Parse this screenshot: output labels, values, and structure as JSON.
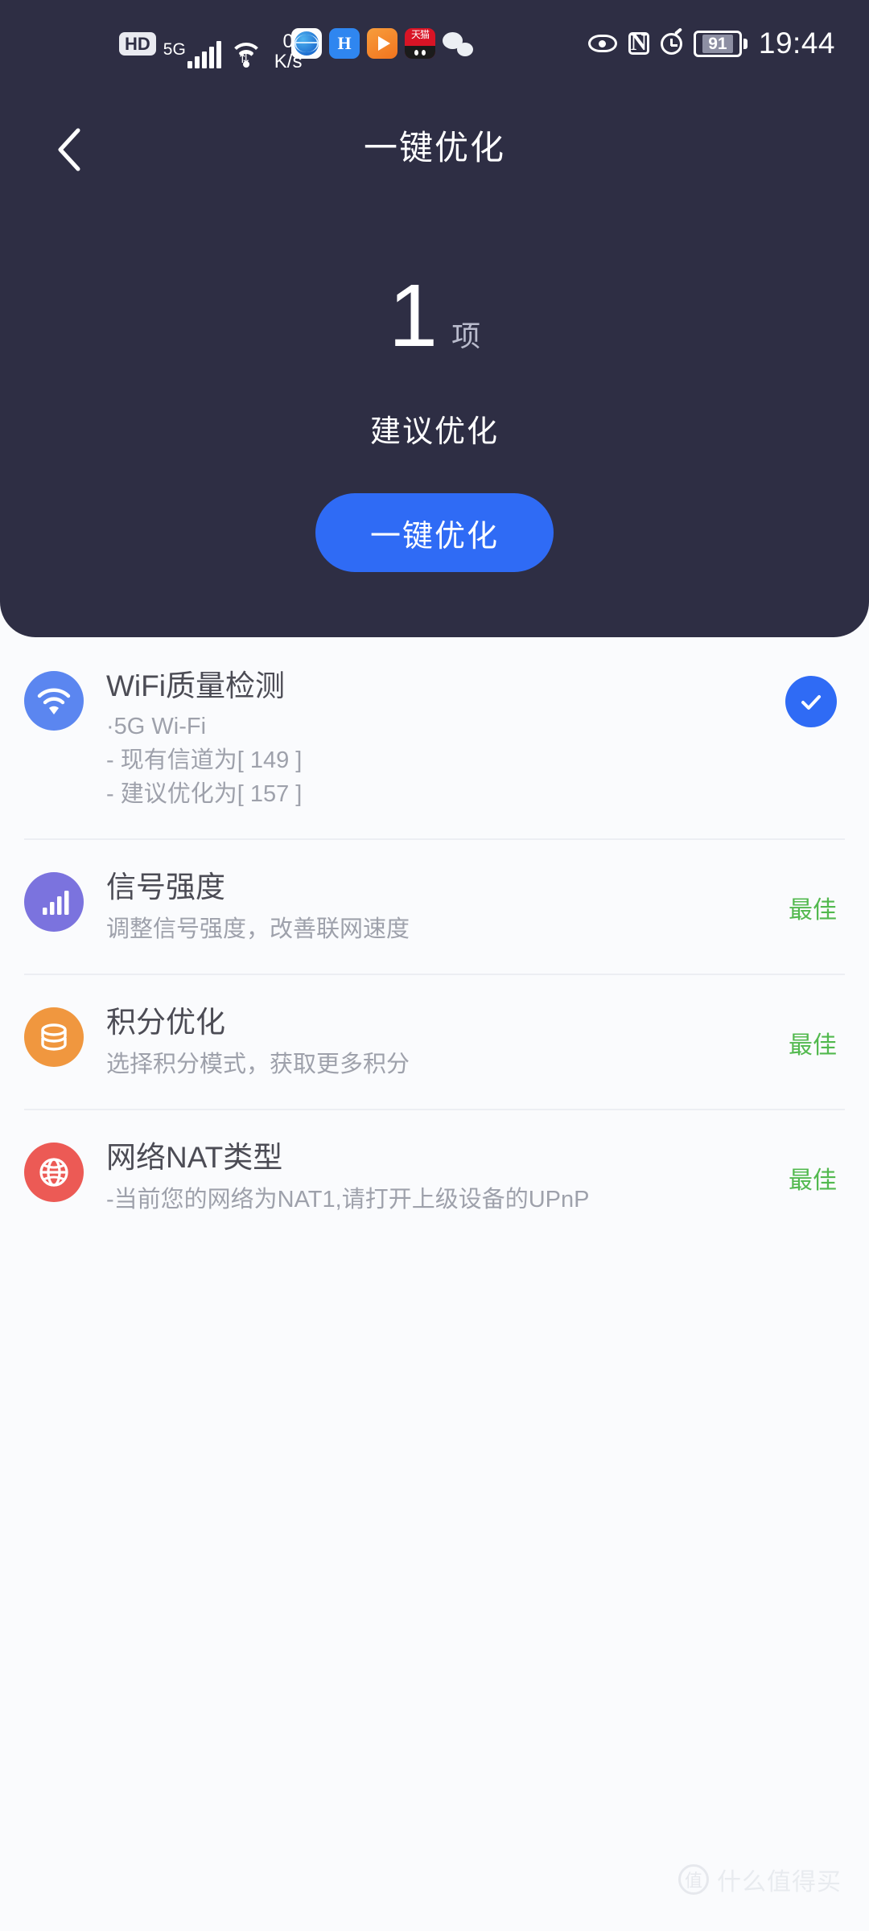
{
  "statusbar": {
    "hd_label": "HD",
    "network_gen": "5G",
    "net_speed_value": "0",
    "net_speed_unit": "K/s",
    "app_icons": [
      {
        "name": "browser-app-icon",
        "label": ""
      },
      {
        "name": "h-app-icon",
        "label": "H"
      },
      {
        "name": "video-play-app-icon",
        "label": ""
      },
      {
        "name": "tmall-app-icon",
        "label": "天猫"
      },
      {
        "name": "wechat-app-icon",
        "label": ""
      }
    ],
    "battery_percent": "91",
    "time": "19:44",
    "icons": [
      "eye-icon",
      "nfc-icon",
      "alarm-icon",
      "battery-icon"
    ],
    "nfc_label": "N"
  },
  "nav": {
    "title": "一键优化",
    "back_icon": "chevron-left-icon"
  },
  "hero": {
    "count": "1",
    "count_unit": "项",
    "count_label": "建议优化",
    "cta_label": "一键优化",
    "bg_color": "#2e2e44",
    "accent_color": "#2f6bf5"
  },
  "list": {
    "items": [
      {
        "icon": "wifi-icon",
        "icon_color": "#5b86f0",
        "title": "WiFi质量检测",
        "detail_lines": [
          "·5G  Wi-Fi",
          "- 现有信道为[ 149 ]",
          "- 建议优化为[ 157 ]"
        ],
        "subtitle": "",
        "status": "",
        "has_check": true
      },
      {
        "icon": "signal-bars-icon",
        "icon_color": "#7b73de",
        "title": "信号强度",
        "detail_lines": [],
        "subtitle": "调整信号强度，改善联网速度",
        "status": "最佳",
        "has_check": false
      },
      {
        "icon": "coins-icon",
        "icon_color": "#f0973f",
        "title": "积分优化",
        "detail_lines": [],
        "subtitle": "选择积分模式，获取更多积分",
        "status": "最佳",
        "has_check": false
      },
      {
        "icon": "globe-icon",
        "icon_color": "#ec5a55",
        "title": "网络NAT类型",
        "detail_lines": [],
        "subtitle": "-当前您的网络为NAT1,请打开上级设备的UPnP",
        "status": "最佳",
        "has_check": false
      }
    ],
    "status_color": "#52b94e"
  },
  "watermark": {
    "logo_char": "值",
    "text": "什么值得买"
  }
}
